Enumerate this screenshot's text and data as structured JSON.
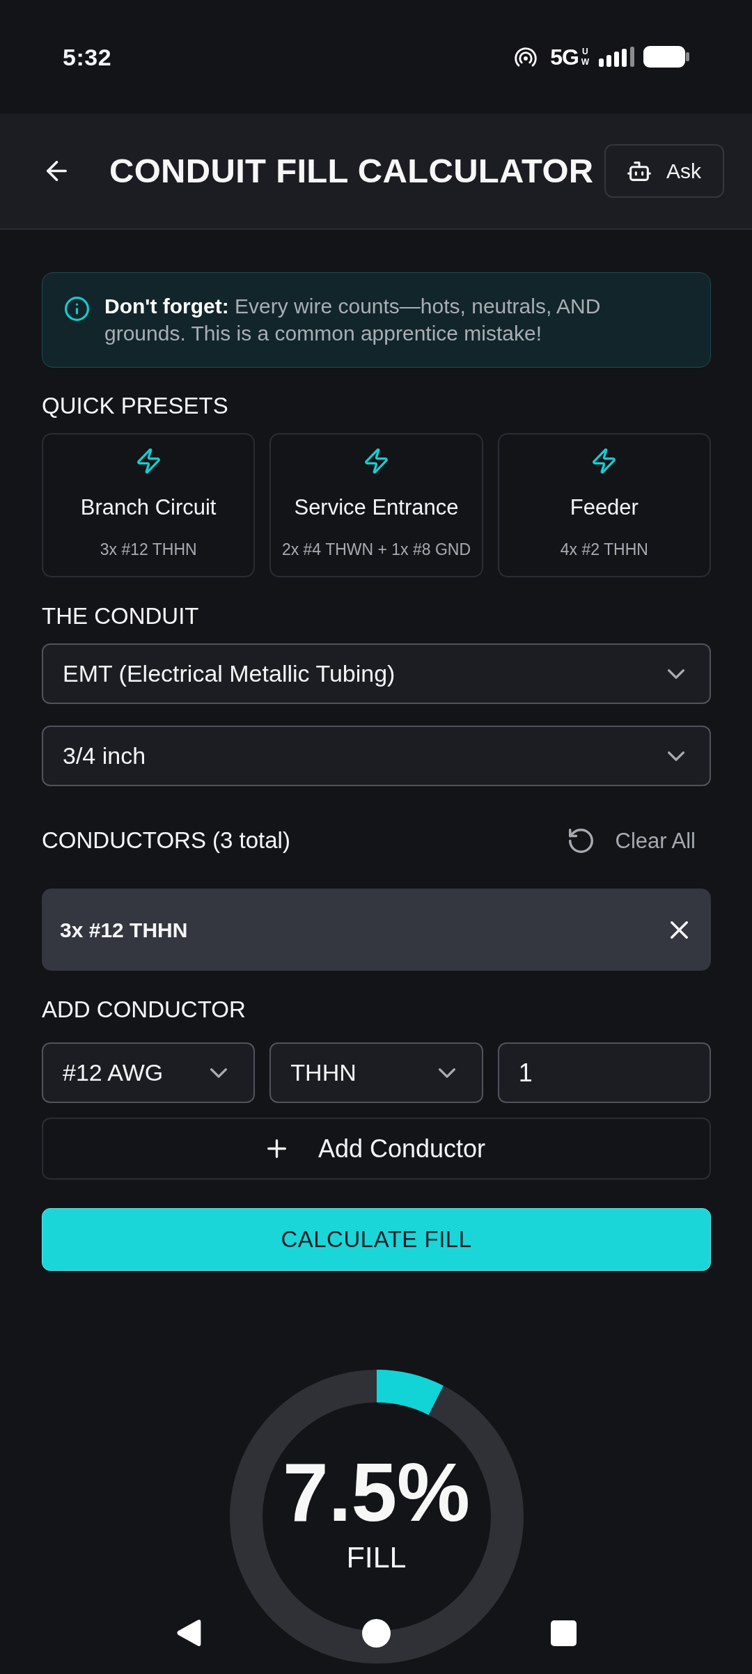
{
  "status_bar": {
    "time": "5:32",
    "network": "5G",
    "network_tag": "UW"
  },
  "header": {
    "title": "CONDUIT FILL CALCULATOR",
    "ask_button": "Ask"
  },
  "alert": {
    "text": "**Don't forget:** Every wire counts—hots, neutrals, AND grounds. This is a common apprentice mistake!"
  },
  "presets": {
    "heading": "QUICK PRESETS",
    "items": [
      {
        "name": "Branch Circuit",
        "detail": "3x #12 THHN"
      },
      {
        "name": "Service Entrance",
        "detail": "2x #4 THWN + 1x #8 GND"
      },
      {
        "name": "Feeder",
        "detail": "4x #2 THHN"
      }
    ]
  },
  "conduit": {
    "heading": "THE CONDUIT",
    "type": "EMT (Electrical Metallic Tubing)",
    "size": "3/4 inch"
  },
  "conductors": {
    "heading": "CONDUCTORS (3 total)",
    "clear_button": "Clear All",
    "items": [
      {
        "label": "3x #12 THHN"
      }
    ]
  },
  "add_conductor": {
    "heading": "ADD CONDUCTOR",
    "gauge": "#12 AWG",
    "insulation": "THHN",
    "quantity": "1",
    "button": "Add Conductor"
  },
  "calculate_button": "CALCULATE FILL",
  "result": {
    "value": "7.5%",
    "label": "FILL",
    "level": 0.075
  }
}
